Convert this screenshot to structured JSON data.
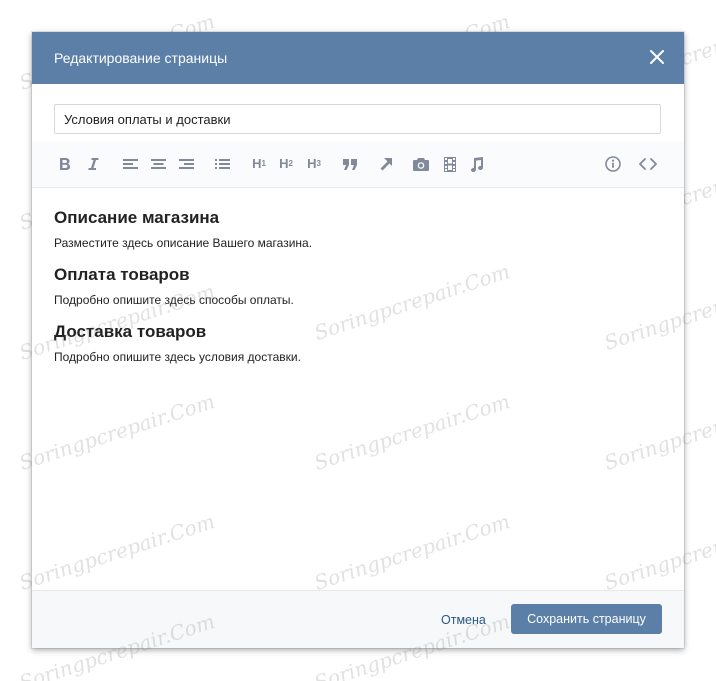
{
  "dialog": {
    "title": "Редактирование страницы"
  },
  "page_title_input": {
    "value": "Условия оплаты и доставки"
  },
  "toolbar": {
    "h1": "H",
    "h2": "H",
    "h3": "H",
    "h1_sub": "1",
    "h2_sub": "2",
    "h3_sub": "3"
  },
  "content": {
    "sections": [
      {
        "heading": "Описание магазина",
        "text": "Разместите здесь описание Вашего магазина."
      },
      {
        "heading": "Оплата товаров",
        "text": "Подробно опишите здесь способы оплаты."
      },
      {
        "heading": "Доставка товаров",
        "text": "Подробно опишите здесь условия доставки."
      }
    ]
  },
  "footer": {
    "cancel_label": "Отмена",
    "save_label": "Сохранить страницу"
  },
  "watermark": "Soringpcrepair.Com",
  "colors": {
    "header_bg": "#5b7fa6",
    "primary_button": "#5b7fa6",
    "link": "#2a5885",
    "icon": "#828a99"
  }
}
